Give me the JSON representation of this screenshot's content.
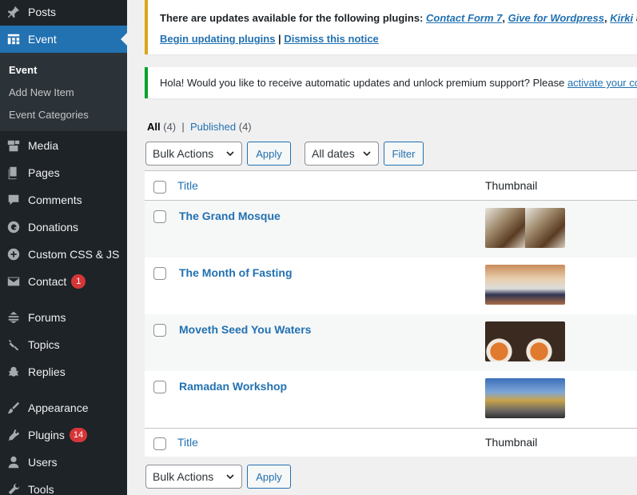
{
  "sidebar": {
    "items": [
      {
        "label": "Posts",
        "icon": "pin-icon"
      },
      {
        "label": "Event",
        "icon": "grid-icon",
        "active": true
      },
      {
        "label": "Media",
        "icon": "media-icon"
      },
      {
        "label": "Pages",
        "icon": "pages-icon"
      },
      {
        "label": "Comments",
        "icon": "comment-icon"
      },
      {
        "label": "Donations",
        "icon": "donation-icon"
      },
      {
        "label": "Custom CSS & JS",
        "icon": "plus-circle-icon"
      },
      {
        "label": "Contact",
        "icon": "mail-icon",
        "badge": "1"
      },
      {
        "label": "Forums",
        "icon": "forums-icon"
      },
      {
        "label": "Topics",
        "icon": "topics-icon"
      },
      {
        "label": "Replies",
        "icon": "replies-icon"
      },
      {
        "label": "Appearance",
        "icon": "brush-icon"
      },
      {
        "label": "Plugins",
        "icon": "plug-icon",
        "badge": "14"
      },
      {
        "label": "Users",
        "icon": "user-icon"
      },
      {
        "label": "Tools",
        "icon": "wrench-icon"
      }
    ],
    "submenu": [
      "Event",
      "Add New Item",
      "Event Categories"
    ]
  },
  "notices": {
    "updates": {
      "prefix": "There are updates available for the following plugins: ",
      "plugins": [
        "Contact Form 7",
        "Give for Wordpress",
        "Kirki"
      ],
      "sep": ", ",
      "suffix": " and",
      "begin_link": "Begin updating plugins",
      "divider": " | ",
      "dismiss_link": "Dismiss this notice"
    },
    "hola": {
      "text": "Hola! Would you like to receive automatic updates and unlock premium support? Please ",
      "link": "activate your copy"
    }
  },
  "views": {
    "all_label": "All",
    "all_count": "(4)",
    "separator": "|",
    "published_label": "Published",
    "published_count": "(4)"
  },
  "bulk_actions": {
    "selected": "Bulk Actions",
    "apply_label": "Apply"
  },
  "date_filter": {
    "selected": "All dates",
    "filter_label": "Filter"
  },
  "table": {
    "columns": {
      "title": "Title",
      "thumbnail": "Thumbnail"
    },
    "rows": [
      {
        "title": "The Grand Mosque",
        "thumb_colors": [
          "#8a7a63",
          "#b5a487"
        ]
      },
      {
        "title": "The Month of Fasting",
        "thumb_colors": [
          "#c9a47a",
          "#3a3f5c"
        ]
      },
      {
        "title": "Moveth Seed You Waters",
        "thumb_colors": [
          "#4a3a2e",
          "#d98b3a"
        ]
      },
      {
        "title": "Ramadan Workshop",
        "thumb_colors": [
          "#3e6fb6",
          "#c9a44b"
        ]
      }
    ]
  },
  "colors": {
    "sidebar_bg": "#1d2327",
    "active_blue": "#2271b1",
    "link_blue": "#2271b1",
    "badge_red": "#d63638",
    "warning_yellow": "#dba617",
    "success_green": "#00a32a"
  }
}
